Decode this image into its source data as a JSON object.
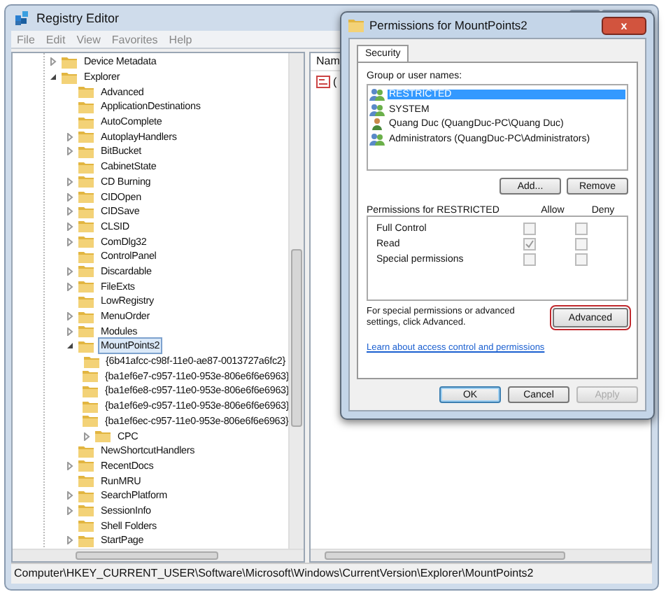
{
  "window": {
    "title": "Registry Editor",
    "menu": [
      "File",
      "Edit",
      "View",
      "Favorites",
      "Help"
    ]
  },
  "tree": [
    {
      "label": "Device Metadata",
      "has_children": true,
      "expanded": false,
      "selected": false
    },
    {
      "label": "Explorer",
      "has_children": true,
      "expanded": true,
      "selected": false,
      "children": [
        {
          "label": "Advanced",
          "has_children": false,
          "expanded": false,
          "selected": false
        },
        {
          "label": "ApplicationDestinations",
          "has_children": false,
          "expanded": false,
          "selected": false
        },
        {
          "label": "AutoComplete",
          "has_children": false,
          "expanded": false,
          "selected": false
        },
        {
          "label": "AutoplayHandlers",
          "has_children": true,
          "expanded": false,
          "selected": false
        },
        {
          "label": "BitBucket",
          "has_children": true,
          "expanded": false,
          "selected": false
        },
        {
          "label": "CabinetState",
          "has_children": false,
          "expanded": false,
          "selected": false
        },
        {
          "label": "CD Burning",
          "has_children": true,
          "expanded": false,
          "selected": false
        },
        {
          "label": "CIDOpen",
          "has_children": true,
          "expanded": false,
          "selected": false
        },
        {
          "label": "CIDSave",
          "has_children": true,
          "expanded": false,
          "selected": false
        },
        {
          "label": "CLSID",
          "has_children": true,
          "expanded": false,
          "selected": false
        },
        {
          "label": "ComDlg32",
          "has_children": true,
          "expanded": false,
          "selected": false
        },
        {
          "label": "ControlPanel",
          "has_children": false,
          "expanded": false,
          "selected": false
        },
        {
          "label": "Discardable",
          "has_children": true,
          "expanded": false,
          "selected": false
        },
        {
          "label": "FileExts",
          "has_children": true,
          "expanded": false,
          "selected": false
        },
        {
          "label": "LowRegistry",
          "has_children": false,
          "expanded": false,
          "selected": false
        },
        {
          "label": "MenuOrder",
          "has_children": true,
          "expanded": false,
          "selected": false
        },
        {
          "label": "Modules",
          "has_children": true,
          "expanded": false,
          "selected": false
        },
        {
          "label": "MountPoints2",
          "has_children": true,
          "expanded": true,
          "selected": true,
          "children": [
            {
              "label": "{6b41afcc-c98f-11e0-ae87-0013727a6fc2}",
              "has_children": false,
              "expanded": false,
              "selected": false
            },
            {
              "label": "{ba1ef6e7-c957-11e0-953e-806e6f6e6963}",
              "has_children": false,
              "expanded": false,
              "selected": false
            },
            {
              "label": "{ba1ef6e8-c957-11e0-953e-806e6f6e6963}",
              "has_children": false,
              "expanded": false,
              "selected": false
            },
            {
              "label": "{ba1ef6e9-c957-11e0-953e-806e6f6e6963}",
              "has_children": false,
              "expanded": false,
              "selected": false
            },
            {
              "label": "{ba1ef6ec-c957-11e0-953e-806e6f6e6963}",
              "has_children": false,
              "expanded": false,
              "selected": false
            },
            {
              "label": "CPC",
              "has_children": true,
              "expanded": false,
              "selected": false
            }
          ]
        },
        {
          "label": "NewShortcutHandlers",
          "has_children": false,
          "expanded": false,
          "selected": false
        },
        {
          "label": "RecentDocs",
          "has_children": true,
          "expanded": false,
          "selected": false
        },
        {
          "label": "RunMRU",
          "has_children": false,
          "expanded": false,
          "selected": false
        },
        {
          "label": "SearchPlatform",
          "has_children": true,
          "expanded": false,
          "selected": false
        },
        {
          "label": "SessionInfo",
          "has_children": true,
          "expanded": false,
          "selected": false
        },
        {
          "label": "Shell Folders",
          "has_children": false,
          "expanded": false,
          "selected": false
        },
        {
          "label": "StartPage",
          "has_children": true,
          "expanded": false,
          "selected": false
        }
      ]
    }
  ],
  "values_pane": {
    "column_1": "Nam",
    "row_1": "("
  },
  "status_bar": "Computer\\HKEY_CURRENT_USER\\Software\\Microsoft\\Windows\\CurrentVersion\\Explorer\\MountPoints2",
  "dialog": {
    "title": "Permissions for MountPoints2",
    "close": "x",
    "tabs": [
      {
        "label": "Security",
        "selected": true
      }
    ],
    "users_label": "Group or user names:",
    "users": [
      {
        "name": "RESTRICTED",
        "kind": "group",
        "selected": true
      },
      {
        "name": "SYSTEM",
        "kind": "group",
        "selected": false
      },
      {
        "name": "Quang Duc (QuangDuc-PC\\Quang Duc)",
        "kind": "user",
        "selected": false
      },
      {
        "name": "Administrators (QuangDuc-PC\\Administrators)",
        "kind": "group",
        "selected": false
      }
    ],
    "user_buttons": [
      "Add...",
      "Remove"
    ],
    "permissions_label": "Permissions for RESTRICTED",
    "allow_header": "Allow",
    "deny_header": "Deny",
    "permissions": [
      {
        "name": "Full Control",
        "allow": false,
        "deny": false
      },
      {
        "name": "Read",
        "allow": true,
        "deny": false
      },
      {
        "name": "Special permissions",
        "allow": false,
        "deny": false
      }
    ],
    "advanced_note": "For special permissions or advanced settings, click Advanced.",
    "advanced_button": {
      "label": "Advanced",
      "highlighted": true
    },
    "link": "Learn about access control and permissions",
    "buttons": [
      {
        "label": "OK",
        "disabled": false,
        "default": true
      },
      {
        "label": "Cancel",
        "disabled": false,
        "default": false
      },
      {
        "label": "Apply",
        "disabled": true,
        "default": false
      }
    ]
  }
}
